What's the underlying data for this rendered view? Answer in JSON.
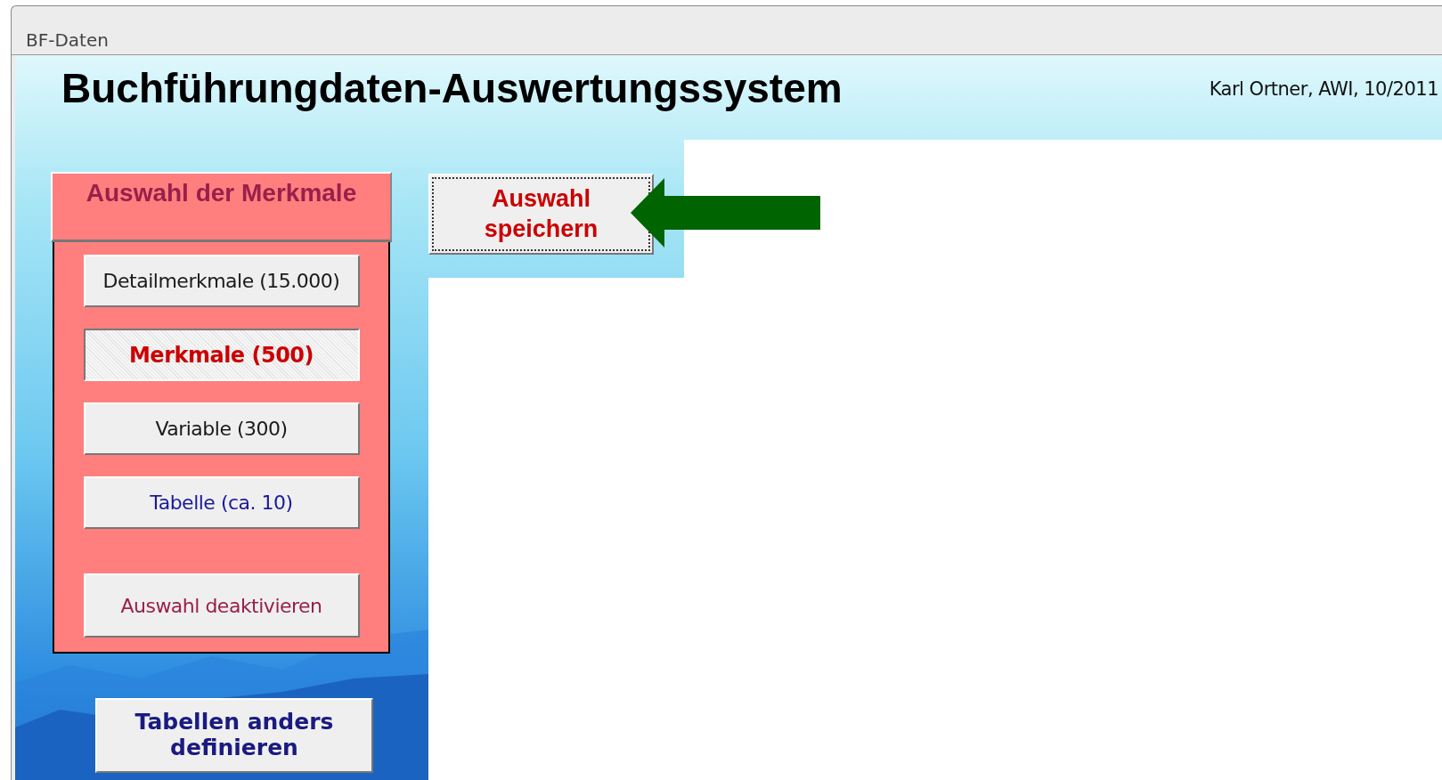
{
  "window": {
    "title": "BF-Daten"
  },
  "header": {
    "title": "Buchführungdaten-Auswertungssystem",
    "author": "Karl Ortner, AWI, 10/2011"
  },
  "selection_panel": {
    "title": "Auswahl der Merkmale",
    "buttons": [
      {
        "label": "Detailmerkmale (15.000)",
        "selected": false,
        "color": "#1a1a1a",
        "kind": "option"
      },
      {
        "label": "Merkmale (500)",
        "selected": true,
        "color": "#cc0000",
        "kind": "option"
      },
      {
        "label": "Variable (300)",
        "selected": false,
        "color": "#1a1a1a",
        "kind": "option"
      },
      {
        "label": "Tabelle (ca. 10)",
        "selected": false,
        "color": "#1a1a99",
        "kind": "option"
      },
      {
        "label": "Auswahl deaktivieren",
        "selected": false,
        "color": "#99204a",
        "kind": "reset"
      }
    ]
  },
  "save_button": {
    "label": "Auswahl speichern"
  },
  "tables_button": {
    "label": "Tabellen anders definieren"
  }
}
